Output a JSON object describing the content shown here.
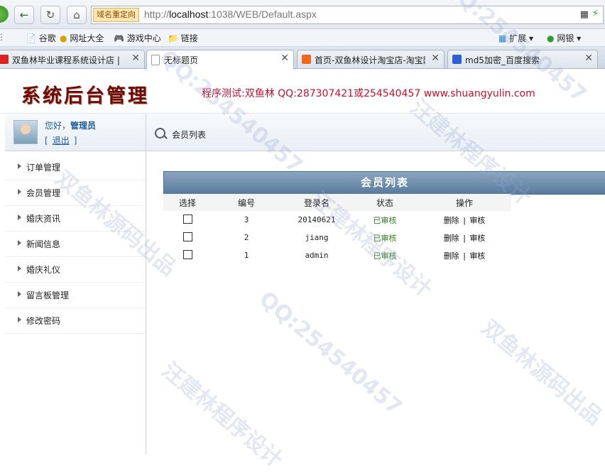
{
  "browser": {
    "redirect_label": "域名重定向",
    "url_prefix": "http://",
    "url_host": "localhost",
    "url_rest": ":1038/WEB/Default.aspx",
    "bookmarks": [
      "谷歌",
      "网址大全",
      "游戏中心",
      "链接"
    ],
    "extensions_label": "扩展",
    "wallet_label": "网银",
    "tabs": [
      {
        "label": "双鱼林毕业课程系统设计店 |",
        "active": false
      },
      {
        "label": "无标题页",
        "active": true
      },
      {
        "label": "首页-双鱼林设计淘宝店-淘宝网",
        "active": false
      },
      {
        "label": "md5加密_百度搜索",
        "active": false
      }
    ]
  },
  "header": {
    "title": "系统后台管理",
    "tagline": "程序测试:双鱼林 QQ:287307421或254540457 www.shuangyulin.com"
  },
  "user": {
    "greeting": "您好，",
    "name": "管理员",
    "logout_open": "[",
    "logout": "退出",
    "logout_close": "]"
  },
  "menu": [
    "订单管理",
    "会员管理",
    "婚庆资讯",
    "新闻信息",
    "婚庆礼仪",
    "留言板管理",
    "修改密码"
  ],
  "breadcrumb": "会员列表",
  "table": {
    "title": "会员列表",
    "columns": [
      "选择",
      "编号",
      "登录名",
      "状态",
      "操作"
    ],
    "rows": [
      {
        "id": "3",
        "login": "20140621",
        "status": "已审核",
        "delete": "删除",
        "sep": "|",
        "audit": "审核"
      },
      {
        "id": "2",
        "login": "jiang",
        "status": "已审核",
        "delete": "删除",
        "sep": "|",
        "audit": "审核"
      },
      {
        "id": "1",
        "login": "admin",
        "status": "已审核",
        "delete": "删除",
        "sep": "|",
        "audit": "审核"
      }
    ]
  },
  "watermarks": [
    "QQ:254540457",
    "双鱼林源码出品",
    "汪建林程序设计",
    "QQ:254540457",
    "汪建林程序设计",
    "双鱼林源码出品",
    "QQ:254540457",
    "汪建林程序设计"
  ]
}
